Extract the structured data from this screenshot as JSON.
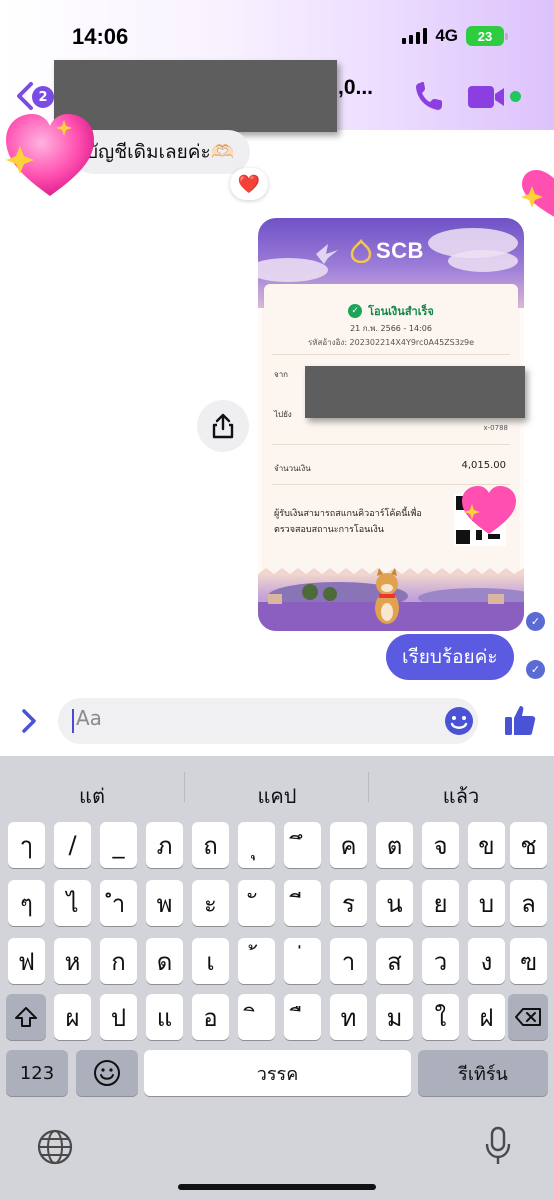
{
  "status_bar": {
    "time": "14:06",
    "network": "4G",
    "battery": "23"
  },
  "header": {
    "back_badge": "2",
    "contact_name_suffix": ",0..."
  },
  "messages": {
    "incoming_text": "บัญชีเดิมเลยค่ะ🫶🏻",
    "reaction": "❤️",
    "outgoing_text": "เรียบร้อยค่ะ"
  },
  "receipt": {
    "bank": "SCB",
    "status": "โอนเงินสำเร็จ",
    "date": "21 ก.พ. 2566 - 14:06",
    "ref": "รหัสอ้างอิง: 202302214X4Y9rc0A45ZS3z9e",
    "from_label": "จาก",
    "to_label": "ไปยัง",
    "to_account": "x-0788",
    "amount_label": "จำนวนเงิน",
    "amount": "4,015.00",
    "note": "ผู้รับเงินสามารถสแกนคิวอาร์โค้ดนี้เพื่อตรวจสอบสถานะการโอนเงิน"
  },
  "composer": {
    "placeholder": "Aa"
  },
  "keyboard": {
    "suggestions": [
      "แต่",
      "แคป",
      "แล้ว"
    ],
    "rows": [
      [
        "ๅ",
        "/",
        "_",
        "ภ",
        "ถ",
        "ุ",
        "ึ",
        "ค",
        "ต",
        "จ",
        "ข",
        "ช"
      ],
      [
        "ๆ",
        "ไ",
        "ำ",
        "พ",
        "ะ",
        "ั",
        "ี",
        "ร",
        "น",
        "ย",
        "บ",
        "ล"
      ],
      [
        "ฟ",
        "ห",
        "ก",
        "ด",
        "เ",
        "้",
        "่",
        "า",
        "ส",
        "ว",
        "ง",
        "ฃ"
      ],
      [
        "ผ",
        "ป",
        "แ",
        "อ",
        "ิ",
        "ื",
        "ท",
        "ม",
        "ใ",
        "ฝ"
      ]
    ],
    "numbers_key": "123",
    "space_key": "วรรค",
    "return_key": "รีเทิร์น"
  },
  "colors": {
    "accent": "#7b4ce4",
    "outgoing_bubble": "#5a5be0",
    "online": "#22c55e"
  }
}
